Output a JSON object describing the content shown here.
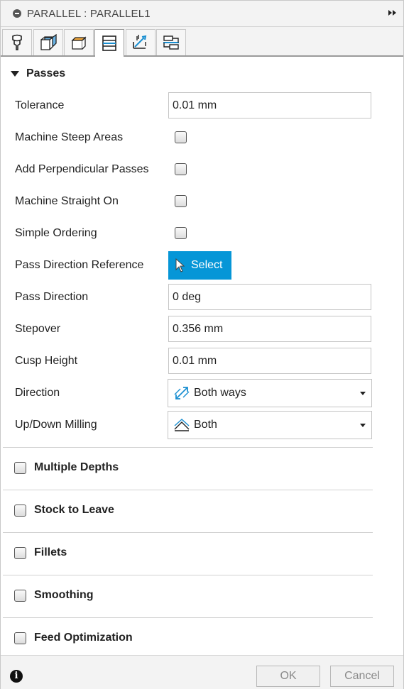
{
  "title": "PARALLEL : PARALLEL1",
  "tabs": [
    {
      "icon": "tool-icon"
    },
    {
      "icon": "geometry-icon"
    },
    {
      "icon": "heights-icon"
    },
    {
      "icon": "passes-icon",
      "active": true
    },
    {
      "icon": "linking-icon"
    },
    {
      "icon": "feed-icon"
    }
  ],
  "passes": {
    "header": "Passes",
    "tolerance_label": "Tolerance",
    "tolerance_value": "0.01 mm",
    "machine_steep_label": "Machine Steep Areas",
    "machine_steep_checked": false,
    "add_perpendicular_label": "Add Perpendicular Passes",
    "add_perpendicular_checked": false,
    "machine_straight_label": "Machine Straight On",
    "machine_straight_checked": false,
    "simple_ordering_label": "Simple Ordering",
    "simple_ordering_checked": false,
    "pass_direction_ref_label": "Pass Direction Reference",
    "select_label": "Select",
    "pass_direction_label": "Pass Direction",
    "pass_direction_value": "0 deg",
    "stepover_label": "Stepover",
    "stepover_value": "0.356 mm",
    "cusp_height_label": "Cusp Height",
    "cusp_height_value": "0.01 mm",
    "direction_label": "Direction",
    "direction_value": "Both ways",
    "updown_label": "Up/Down Milling",
    "updown_value": "Both"
  },
  "sections": {
    "multiple_depths": "Multiple Depths",
    "stock_to_leave": "Stock to Leave",
    "fillets": "Fillets",
    "smoothing": "Smoothing",
    "feed_optimization": "Feed Optimization"
  },
  "footer": {
    "ok_label": "OK",
    "cancel_label": "Cancel"
  },
  "colors": {
    "accent": "#0696d7",
    "icon_blue": "#1a8fd1"
  }
}
